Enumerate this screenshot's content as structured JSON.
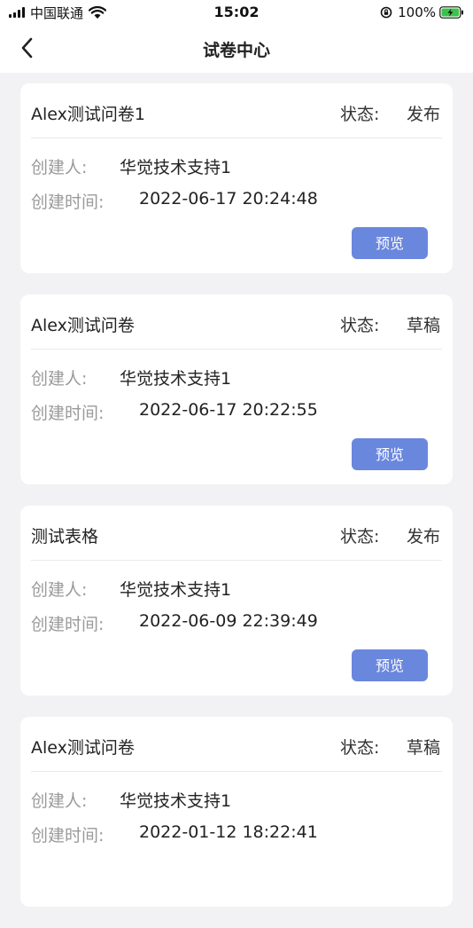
{
  "status_bar": {
    "carrier": "中国联通",
    "time": "15:02",
    "battery": "100%"
  },
  "nav": {
    "title": "试卷中心"
  },
  "labels": {
    "status": "状态:",
    "creator": "创建人:",
    "created_time": "创建时间:",
    "preview": "预览"
  },
  "papers": [
    {
      "title": "Alex测试问卷1",
      "status": "发布",
      "creator": "华觉技术支持1",
      "created_time": "2022-06-17 20:24:48"
    },
    {
      "title": "Alex测试问卷",
      "status": "草稿",
      "creator": "华觉技术支持1",
      "created_time": "2022-06-17 20:22:55"
    },
    {
      "title": "测试表格",
      "status": "发布",
      "creator": "华觉技术支持1",
      "created_time": "2022-06-09 22:39:49"
    },
    {
      "title": "Alex测试问卷",
      "status": "草稿",
      "creator": "华觉技术支持1",
      "created_time": "2022-01-12 18:22:41"
    }
  ],
  "colors": {
    "accent": "#6a87de",
    "background": "#f2f2f4"
  }
}
